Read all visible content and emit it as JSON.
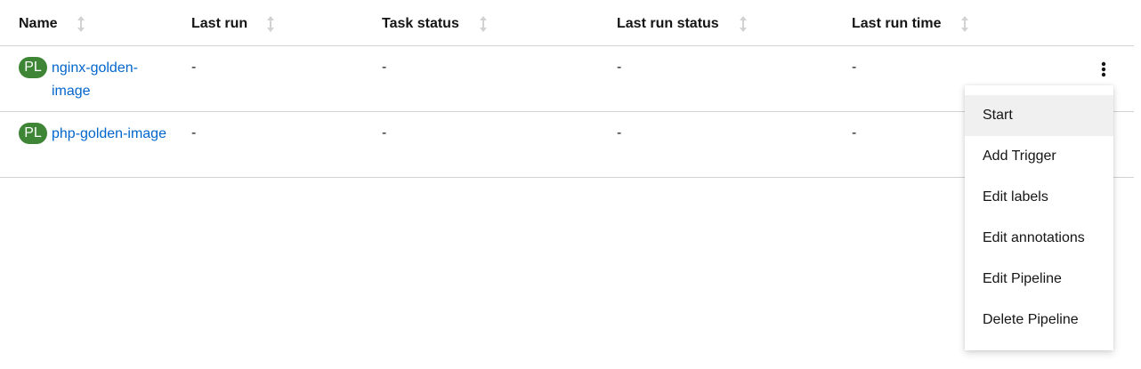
{
  "table": {
    "columns": [
      {
        "label": "Name"
      },
      {
        "label": "Last run"
      },
      {
        "label": "Task status"
      },
      {
        "label": "Last run status"
      },
      {
        "label": "Last run time"
      }
    ],
    "rows": [
      {
        "badge": "PL",
        "name": "nginx-golden-image",
        "last_run": "-",
        "task_status": "-",
        "last_run_status": "-",
        "last_run_time": "-"
      },
      {
        "badge": "PL",
        "name": "php-golden-image",
        "last_run": "-",
        "task_status": "-",
        "last_run_status": "-",
        "last_run_time": "-"
      }
    ]
  },
  "kebab_menu": {
    "items": [
      {
        "label": "Start"
      },
      {
        "label": "Add Trigger"
      },
      {
        "label": "Edit labels"
      },
      {
        "label": "Edit annotations"
      },
      {
        "label": "Edit Pipeline"
      },
      {
        "label": "Delete Pipeline"
      }
    ]
  },
  "colors": {
    "link": "#0066cc",
    "badge": "#3e8635",
    "border": "#d2d2d2",
    "sort_icon": "#d2d2d2"
  },
  "icons": {
    "sort": "sort-arrows-icon",
    "kebab": "kebab-vertical-icon"
  }
}
